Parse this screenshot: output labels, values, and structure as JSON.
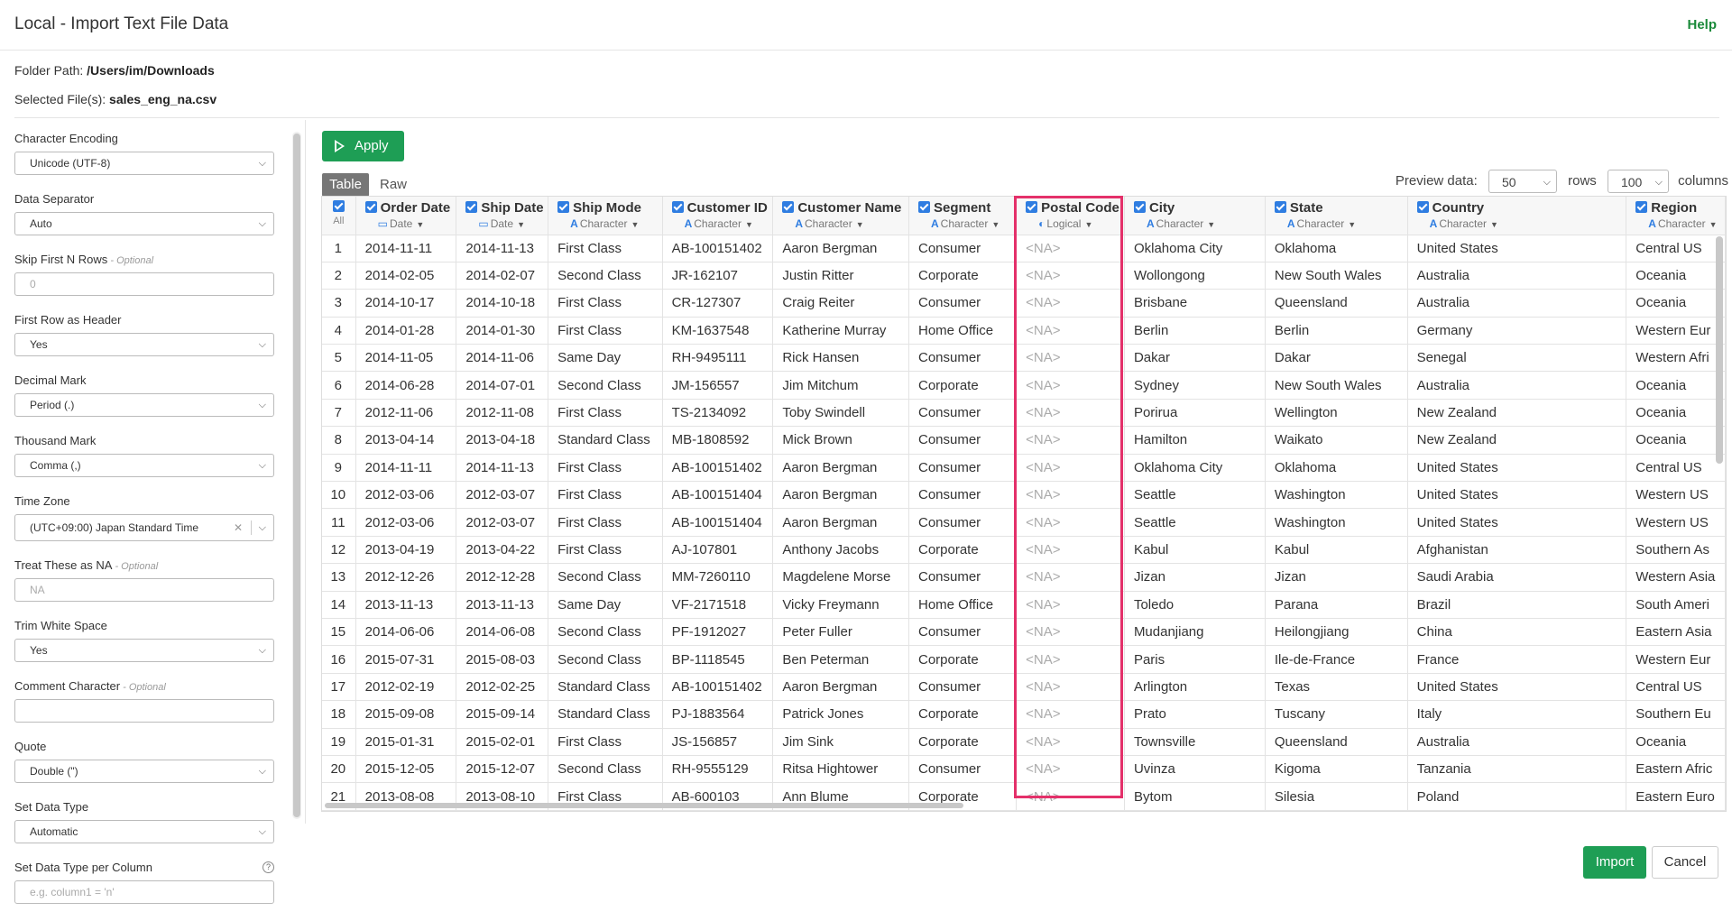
{
  "header": {
    "title": "Local - Import Text File Data",
    "help": "Help"
  },
  "file": {
    "folder_label": "Folder Path:",
    "folder_value": "/Users/im/Downloads",
    "files_label": "Selected File(s):",
    "files_value": "sales_eng_na.csv"
  },
  "sidebar": {
    "fields": [
      {
        "label": "Character Encoding",
        "optional": "",
        "type": "select",
        "value": "Unicode (UTF-8)"
      },
      {
        "label": "Data Separator",
        "optional": "",
        "type": "select",
        "value": "Auto"
      },
      {
        "label": "Skip First N Rows",
        "optional": " - Optional",
        "type": "text",
        "value": "0"
      },
      {
        "label": "First Row as Header",
        "optional": "",
        "type": "select",
        "value": "Yes"
      },
      {
        "label": "Decimal Mark",
        "optional": "",
        "type": "select",
        "value": "Period (.)"
      },
      {
        "label": "Thousand Mark",
        "optional": "",
        "type": "select",
        "value": "Comma (,)"
      },
      {
        "label": "Time Zone",
        "optional": "",
        "type": "tz",
        "value": "(UTC+09:00) Japan Standard Time"
      },
      {
        "label": "Treat These as NA",
        "optional": " - Optional",
        "type": "text",
        "value": "NA"
      },
      {
        "label": "Trim White Space",
        "optional": "",
        "type": "select",
        "value": "Yes"
      },
      {
        "label": "Comment Character",
        "optional": " - Optional",
        "type": "text",
        "value": ""
      },
      {
        "label": "Quote",
        "optional": "",
        "type": "select",
        "value": "Double (\")"
      },
      {
        "label": "Set Data Type",
        "optional": "",
        "type": "select",
        "value": "Automatic"
      },
      {
        "label": "Set Data Type per Column",
        "optional": "",
        "type": "text",
        "value": "e.g. column1 = 'n'",
        "help": "?"
      }
    ]
  },
  "toolbar": {
    "apply": "Apply",
    "tab_table": "Table",
    "tab_raw": "Raw"
  },
  "preview": {
    "label": "Preview data:",
    "rows_value": "50",
    "rows_label": "rows",
    "cols_value": "100",
    "cols_label": "columns"
  },
  "table": {
    "all_label": "All",
    "columns": [
      {
        "name": "Order Date",
        "type": "Date",
        "icon": "calendar-icon",
        "glyph": "▭"
      },
      {
        "name": "Ship Date",
        "type": "Date",
        "icon": "calendar-icon",
        "glyph": "▭"
      },
      {
        "name": "Ship Mode",
        "type": "Character",
        "icon": "character-icon",
        "glyph": "A"
      },
      {
        "name": "Customer ID",
        "type": "Character",
        "icon": "character-icon",
        "glyph": "A"
      },
      {
        "name": "Customer Name",
        "type": "Character",
        "icon": "character-icon",
        "glyph": "A"
      },
      {
        "name": "Segment",
        "type": "Character",
        "icon": "character-icon",
        "glyph": "A"
      },
      {
        "name": "Postal Code",
        "type": "Logical",
        "icon": "toggle-icon",
        "glyph": "◐"
      },
      {
        "name": "City",
        "type": "Character",
        "icon": "character-icon",
        "glyph": "A"
      },
      {
        "name": "State",
        "type": "Character",
        "icon": "character-icon",
        "glyph": "A"
      },
      {
        "name": "Country",
        "type": "Character",
        "icon": "character-icon",
        "glyph": "A"
      },
      {
        "name": "Region",
        "type": "Character",
        "icon": "character-icon",
        "glyph": "A"
      }
    ],
    "rows": [
      [
        "1",
        "2014-11-11",
        "2014-11-13",
        "First Class",
        "AB-100151402",
        "Aaron Bergman",
        "Consumer",
        "<NA>",
        "Oklahoma City",
        "Oklahoma",
        "United States",
        "Central US"
      ],
      [
        "2",
        "2014-02-05",
        "2014-02-07",
        "Second Class",
        "JR-162107",
        "Justin Ritter",
        "Corporate",
        "<NA>",
        "Wollongong",
        "New South Wales",
        "Australia",
        "Oceania"
      ],
      [
        "3",
        "2014-10-17",
        "2014-10-18",
        "First Class",
        "CR-127307",
        "Craig Reiter",
        "Consumer",
        "<NA>",
        "Brisbane",
        "Queensland",
        "Australia",
        "Oceania"
      ],
      [
        "4",
        "2014-01-28",
        "2014-01-30",
        "First Class",
        "KM-1637548",
        "Katherine Murray",
        "Home Office",
        "<NA>",
        "Berlin",
        "Berlin",
        "Germany",
        "Western Eur"
      ],
      [
        "5",
        "2014-11-05",
        "2014-11-06",
        "Same Day",
        "RH-9495111",
        "Rick Hansen",
        "Consumer",
        "<NA>",
        "Dakar",
        "Dakar",
        "Senegal",
        "Western Afri"
      ],
      [
        "6",
        "2014-06-28",
        "2014-07-01",
        "Second Class",
        "JM-156557",
        "Jim Mitchum",
        "Corporate",
        "<NA>",
        "Sydney",
        "New South Wales",
        "Australia",
        "Oceania"
      ],
      [
        "7",
        "2012-11-06",
        "2012-11-08",
        "First Class",
        "TS-2134092",
        "Toby Swindell",
        "Consumer",
        "<NA>",
        "Porirua",
        "Wellington",
        "New Zealand",
        "Oceania"
      ],
      [
        "8",
        "2013-04-14",
        "2013-04-18",
        "Standard Class",
        "MB-1808592",
        "Mick Brown",
        "Consumer",
        "<NA>",
        "Hamilton",
        "Waikato",
        "New Zealand",
        "Oceania"
      ],
      [
        "9",
        "2014-11-11",
        "2014-11-13",
        "First Class",
        "AB-100151402",
        "Aaron Bergman",
        "Consumer",
        "<NA>",
        "Oklahoma City",
        "Oklahoma",
        "United States",
        "Central US"
      ],
      [
        "10",
        "2012-03-06",
        "2012-03-07",
        "First Class",
        "AB-100151404",
        "Aaron Bergman",
        "Consumer",
        "<NA>",
        "Seattle",
        "Washington",
        "United States",
        "Western US"
      ],
      [
        "11",
        "2012-03-06",
        "2012-03-07",
        "First Class",
        "AB-100151404",
        "Aaron Bergman",
        "Consumer",
        "<NA>",
        "Seattle",
        "Washington",
        "United States",
        "Western US"
      ],
      [
        "12",
        "2013-04-19",
        "2013-04-22",
        "First Class",
        "AJ-107801",
        "Anthony Jacobs",
        "Corporate",
        "<NA>",
        "Kabul",
        "Kabul",
        "Afghanistan",
        "Southern As"
      ],
      [
        "13",
        "2012-12-26",
        "2012-12-28",
        "Second Class",
        "MM-7260110",
        "Magdelene Morse",
        "Consumer",
        "<NA>",
        "Jizan",
        "Jizan",
        "Saudi Arabia",
        "Western Asia"
      ],
      [
        "14",
        "2013-11-13",
        "2013-11-13",
        "Same Day",
        "VF-2171518",
        "Vicky Freymann",
        "Home Office",
        "<NA>",
        "Toledo",
        "Parana",
        "Brazil",
        "South Ameri"
      ],
      [
        "15",
        "2014-06-06",
        "2014-06-08",
        "Second Class",
        "PF-1912027",
        "Peter Fuller",
        "Consumer",
        "<NA>",
        "Mudanjiang",
        "Heilongjiang",
        "China",
        "Eastern Asia"
      ],
      [
        "16",
        "2015-07-31",
        "2015-08-03",
        "Second Class",
        "BP-1118545",
        "Ben Peterman",
        "Corporate",
        "<NA>",
        "Paris",
        "Ile-de-France",
        "France",
        "Western Eur"
      ],
      [
        "17",
        "2012-02-19",
        "2012-02-25",
        "Standard Class",
        "AB-100151402",
        "Aaron Bergman",
        "Consumer",
        "<NA>",
        "Arlington",
        "Texas",
        "United States",
        "Central US"
      ],
      [
        "18",
        "2015-09-08",
        "2015-09-14",
        "Standard Class",
        "PJ-1883564",
        "Patrick Jones",
        "Corporate",
        "<NA>",
        "Prato",
        "Tuscany",
        "Italy",
        "Southern Eu"
      ],
      [
        "19",
        "2015-01-31",
        "2015-02-01",
        "First Class",
        "JS-156857",
        "Jim Sink",
        "Corporate",
        "<NA>",
        "Townsville",
        "Queensland",
        "Australia",
        "Oceania"
      ],
      [
        "20",
        "2015-12-05",
        "2015-12-07",
        "Second Class",
        "RH-9555129",
        "Ritsa Hightower",
        "Consumer",
        "<NA>",
        "Uvinza",
        "Kigoma",
        "Tanzania",
        "Eastern Afric"
      ],
      [
        "21",
        "2013-08-08",
        "2013-08-10",
        "First Class",
        "AB-600103",
        "Ann Blume",
        "Corporate",
        "<NA>",
        "Bytom",
        "Silesia",
        "Poland",
        "Eastern Euro"
      ]
    ]
  },
  "footer": {
    "import": "Import",
    "cancel": "Cancel"
  },
  "colors": {
    "accent_green": "#1e9e55",
    "checkbox_blue": "#2f7de1",
    "highlight_pink": "#e4306a",
    "help_green": "#1a8a3a"
  }
}
